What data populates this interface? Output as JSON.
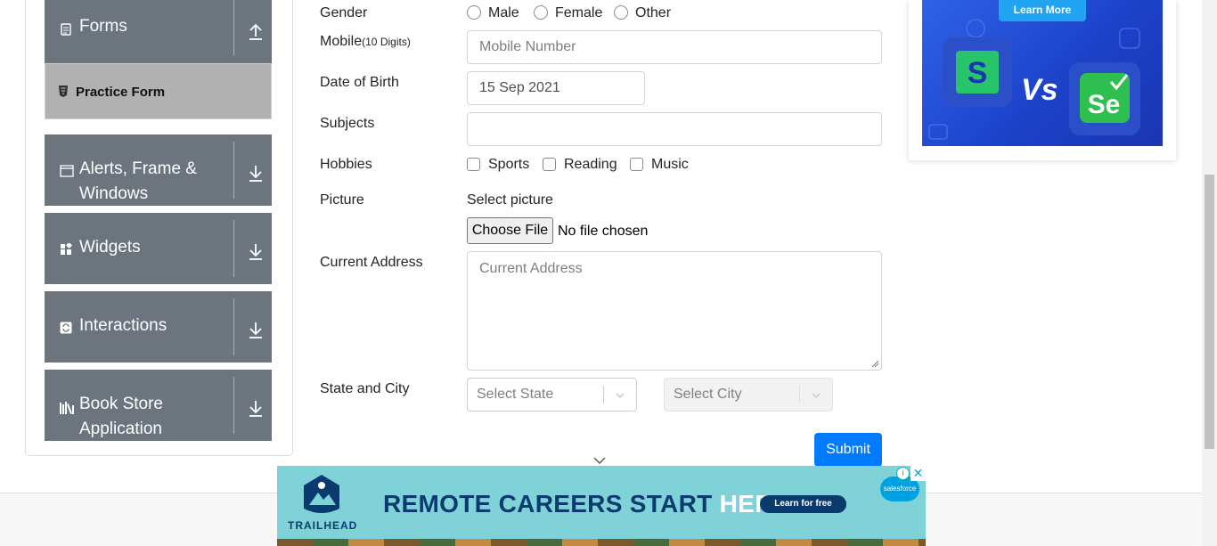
{
  "sidebar": {
    "groups": [
      {
        "label": "Forms",
        "icon": "document-icon",
        "arrow": "arrow-up-icon"
      },
      {
        "label": "Alerts, Frame &",
        "label2": "Windows",
        "icon": "window-icon",
        "arrow": "arrow-down-icon"
      },
      {
        "label": "Widgets",
        "icon": "widgets-icon",
        "arrow": "arrow-down-icon"
      },
      {
        "label": "Interactions",
        "icon": "interactions-icon",
        "arrow": "arrow-down-icon"
      },
      {
        "label": "Book Store",
        "label2": "Application",
        "icon": "books-icon",
        "arrow": "arrow-down-icon"
      }
    ],
    "active_item": {
      "label": "Practice Form",
      "icon": "html-icon"
    }
  },
  "form": {
    "gender": {
      "label": "Gender",
      "options": [
        "Male",
        "Female",
        "Other"
      ]
    },
    "mobile": {
      "label": "Mobile",
      "hint": "(10 Digits)",
      "placeholder": "Mobile Number",
      "value": ""
    },
    "dob": {
      "label": "Date of Birth",
      "value": "15 Sep 2021"
    },
    "subjects": {
      "label": "Subjects",
      "value": ""
    },
    "hobbies": {
      "label": "Hobbies",
      "options": [
        "Sports",
        "Reading",
        "Music"
      ]
    },
    "picture": {
      "label": "Picture",
      "caption": "Select picture",
      "button": "Choose File",
      "status": "No file chosen"
    },
    "address": {
      "label": "Current Address",
      "placeholder": "Current Address",
      "value": ""
    },
    "state_city": {
      "label": "State and City",
      "state_placeholder": "Select State",
      "city_placeholder": "Select City"
    },
    "submit_label": "Submit"
  },
  "right_ad": {
    "cta": "Learn More",
    "vs_text": "Vs"
  },
  "bottom_ad": {
    "headline_main": "REMOTE CAREERS START",
    "headline_accent": "HERE.",
    "cta": "Learn for free",
    "brand": "TRAILHEAD",
    "partner": "salesforce",
    "close_symbol": "✕",
    "info_symbol": "i"
  },
  "colors": {
    "sidebar_group_bg": "#6c757d",
    "active_item_bg": "#b1b1b1",
    "submit_bg": "#007bff",
    "right_ad_bg": "#2454dc",
    "bottom_ad_bg": "#7fd3d8"
  }
}
